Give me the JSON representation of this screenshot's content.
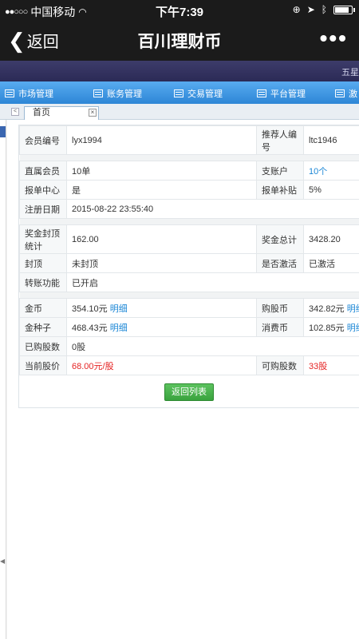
{
  "status_bar": {
    "carrier": "中国移动",
    "time": "下午7:39"
  },
  "nav": {
    "back_label": "返回",
    "title": "百川理财币",
    "more_label": "•••"
  },
  "banner": {
    "corner_text": "五星"
  },
  "menu": {
    "items": [
      "市场管理",
      "账务管理",
      "交易管理",
      "平台管理",
      "激"
    ]
  },
  "tabs": {
    "home_label": "首页",
    "close_label": "×",
    "prev_label": "<"
  },
  "member": {
    "id_label": "会员编号",
    "id_value": "lyx1994",
    "referrer_label": "推荐人编号",
    "referrer_value": "ltc1946",
    "direct_label": "直属会员",
    "direct_value": "10单",
    "branch_label": "支账户",
    "branch_value": "10个",
    "center_label": "报单中心",
    "center_value": "是",
    "subsidy_label": "报单补贴",
    "subsidy_value": "5%",
    "regdate_label": "注册日期",
    "regdate_value": "2015-08-22 23:55:40"
  },
  "bonus": {
    "cap_label": "奖金封顶统计",
    "cap_value": "162.00",
    "total_label": "奖金总计",
    "total_value": "3428.20",
    "capped_label": "封顶",
    "capped_value": "未封顶",
    "activated_label": "是否激活",
    "activated_value": "已激活",
    "transfer_label": "转账功能",
    "transfer_value": "已开启"
  },
  "wallet": {
    "coin_label": "金币",
    "coin_value": "354.10元",
    "coin_detail": "明细",
    "buy_coin_label": "购股币",
    "buy_coin_value": "342.82元",
    "buy_coin_detail": "明细",
    "seed_label": "金种子",
    "seed_value": "468.43元",
    "seed_detail": "明细",
    "spend_label": "消费币",
    "spend_value": "102.85元",
    "spend_detail": "明细",
    "bought_label": "已购股数",
    "bought_value": "0股",
    "price_label": "当前股价",
    "price_value": "68.00元/股",
    "available_label": "可购股数",
    "available_value": "33股"
  },
  "actions": {
    "back_list": "返回列表"
  },
  "colors": {
    "accent_blue": "#1c87d6",
    "alert_red": "#e52424",
    "button_green": "#4cb450",
    "menu_blue": "#3b95e3"
  }
}
